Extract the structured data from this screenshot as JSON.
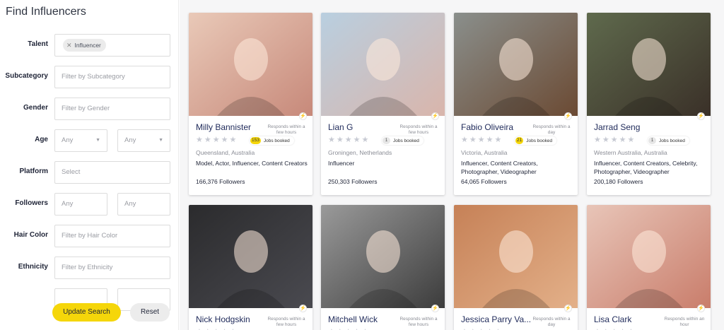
{
  "sidebar": {
    "title": "Find Influencers",
    "filters": {
      "talent": {
        "label": "Talent",
        "chip": "Influencer"
      },
      "subcategory": {
        "label": "Subcategory",
        "placeholder": "Filter by Subcategory"
      },
      "gender": {
        "label": "Gender",
        "placeholder": "Filter by Gender"
      },
      "age": {
        "label": "Age",
        "min": "Any",
        "max": "Any"
      },
      "platform": {
        "label": "Platform",
        "placeholder": "Select"
      },
      "followers": {
        "label": "Followers",
        "min": "Any",
        "max": "Any"
      },
      "hair_color": {
        "label": "Hair Color",
        "placeholder": "Filter by Hair Color"
      },
      "ethnicity": {
        "label": "Ethnicity",
        "placeholder": "Filter by Ethnicity"
      }
    },
    "update_label": "Update Search",
    "reset_label": "Reset",
    "chip_remove_glyph": "✕",
    "caret_glyph": "▼"
  },
  "icons": {
    "star": "★",
    "bolt": "⚡"
  },
  "cards": [
    {
      "name": "Milly Bannister",
      "response": "Responds within a few hours",
      "rating": 5,
      "jobs_count": "153",
      "jobs_label": "Jobs booked",
      "jobs_highlight": true,
      "location": "Queensland, Australia",
      "categories": "Model, Actor, Influencer, Content Creators",
      "followers": "166,376 Followers",
      "photo_colors": [
        "#e9c9b8",
        "#c7897a"
      ]
    },
    {
      "name": "Lian G",
      "response": "Responds within a few hours",
      "rating": 5,
      "jobs_count": "1",
      "jobs_label": "Jobs booked",
      "jobs_highlight": false,
      "location": "Groningen, Netherlands",
      "categories": "Influencer",
      "followers": "250,303 Followers",
      "photo_colors": [
        "#b9cfe0",
        "#d9b5ab"
      ]
    },
    {
      "name": "Fabio Oliveira",
      "response": "Responds within a day",
      "rating": 5,
      "jobs_count": "21",
      "jobs_label": "Jobs booked",
      "jobs_highlight": true,
      "location": "Victoria, Australia",
      "categories": "Influencer, Content Creators, Photographer, Videographer",
      "followers": "64,065 Followers",
      "photo_colors": [
        "#8a8f8c",
        "#6b4a33"
      ]
    },
    {
      "name": "Jarrad Seng",
      "response": "",
      "rating": 5,
      "jobs_count": "1",
      "jobs_label": "Jobs booked",
      "jobs_highlight": false,
      "location": "Western Australia, Australia",
      "categories": "Influencer, Content Creators, Celebrity, Photographer, Videographer",
      "followers": "200,180 Followers",
      "photo_colors": [
        "#5f6a4d",
        "#3a3028"
      ]
    },
    {
      "name": "Nick Hodgskin",
      "response": "Responds within a few hours",
      "rating": 5,
      "jobs_count": "",
      "jobs_label": "",
      "jobs_highlight": false,
      "location": "",
      "categories": "",
      "followers": "",
      "photo_colors": [
        "#2b2b2d",
        "#4a4a50"
      ]
    },
    {
      "name": "Mitchell Wick",
      "response": "Responds within a few hours",
      "rating": 5,
      "jobs_count": "",
      "jobs_label": "",
      "jobs_highlight": false,
      "location": "",
      "categories": "",
      "followers": "",
      "photo_colors": [
        "#9a9a9a",
        "#3c3c3c"
      ]
    },
    {
      "name": "Jessica Parry Va...",
      "response": "Responds within a day",
      "rating": 5,
      "jobs_count": "",
      "jobs_label": "",
      "jobs_highlight": false,
      "location": "",
      "categories": "",
      "followers": "",
      "photo_colors": [
        "#c68157",
        "#e3b089"
      ]
    },
    {
      "name": "Lisa Clark",
      "response": "Responds within an hour",
      "rating": 5,
      "jobs_count": "",
      "jobs_label": "",
      "jobs_highlight": false,
      "location": "",
      "categories": "",
      "followers": "",
      "photo_colors": [
        "#e8c5b8",
        "#c97d6b"
      ]
    }
  ]
}
